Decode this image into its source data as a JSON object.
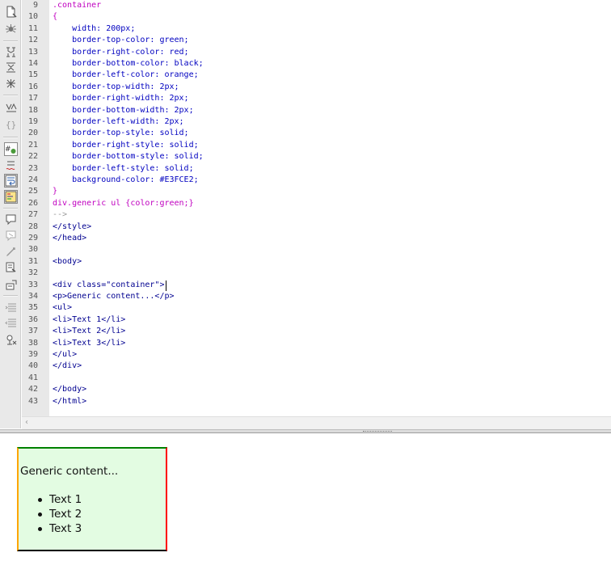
{
  "toolbar": {
    "icons": [
      {
        "name": "open-document-icon",
        "active": false
      },
      {
        "name": "bug-icon",
        "active": false
      },
      {
        "name": "collapse-full-tag-icon",
        "active": false
      },
      {
        "name": "collapse-selection-icon",
        "active": false
      },
      {
        "name": "expand-all-icon",
        "active": false
      },
      {
        "name": "select-parent-tag-icon",
        "active": false
      },
      {
        "name": "balance-braces-icon",
        "active": false
      },
      {
        "name": "line-numbers-icon",
        "active": true
      },
      {
        "name": "highlight-invalid-code-icon",
        "active": false
      },
      {
        "name": "word-wrap-icon",
        "active": true
      },
      {
        "name": "syntax-coloring-icon",
        "active": true
      },
      {
        "name": "apply-comment-icon",
        "active": false
      },
      {
        "name": "remove-comment-icon",
        "active": false
      },
      {
        "name": "wrap-tag-icon",
        "active": false
      },
      {
        "name": "recent-snippets-icon",
        "active": false
      },
      {
        "name": "move-css-icon",
        "active": false
      },
      {
        "name": "indent-code-icon",
        "active": false
      },
      {
        "name": "outdent-code-icon",
        "active": false
      },
      {
        "name": "format-source-icon",
        "active": false
      }
    ]
  },
  "editor": {
    "lines": [
      {
        "num": "9",
        "text": ".container",
        "type": "sel"
      },
      {
        "num": "10",
        "text": "{",
        "type": "sel"
      },
      {
        "num": "11",
        "text": "    width: 200px;",
        "type": "prop"
      },
      {
        "num": "12",
        "text": "    border-top-color: green;",
        "type": "prop"
      },
      {
        "num": "13",
        "text": "    border-right-color: red;",
        "type": "prop"
      },
      {
        "num": "14",
        "text": "    border-bottom-color: black;",
        "type": "prop"
      },
      {
        "num": "15",
        "text": "    border-left-color: orange;",
        "type": "prop"
      },
      {
        "num": "16",
        "text": "    border-top-width: 2px;",
        "type": "prop"
      },
      {
        "num": "17",
        "text": "    border-right-width: 2px;",
        "type": "prop"
      },
      {
        "num": "18",
        "text": "    border-bottom-width: 2px;",
        "type": "prop"
      },
      {
        "num": "19",
        "text": "    border-left-width: 2px;",
        "type": "prop"
      },
      {
        "num": "20",
        "text": "    border-top-style: solid;",
        "type": "prop"
      },
      {
        "num": "21",
        "text": "    border-right-style: solid;",
        "type": "prop"
      },
      {
        "num": "22",
        "text": "    border-bottom-style: solid;",
        "type": "prop"
      },
      {
        "num": "23",
        "text": "    border-left-style: solid;",
        "type": "prop"
      },
      {
        "num": "24",
        "text": "    background-color: #E3FCE2;",
        "type": "prop"
      },
      {
        "num": "25",
        "text": "}",
        "type": "sel"
      },
      {
        "num": "26",
        "text": "div.generic ul {color:green;}",
        "type": "sel"
      },
      {
        "num": "27",
        "text": "-->",
        "type": "cmt"
      },
      {
        "num": "28",
        "text": "</style>",
        "type": "tag"
      },
      {
        "num": "29",
        "text": "</head>",
        "type": "tag"
      },
      {
        "num": "30",
        "text": "",
        "type": "tag"
      },
      {
        "num": "31",
        "text": "<body>",
        "type": "tag"
      },
      {
        "num": "32",
        "text": "",
        "type": "tag"
      },
      {
        "num": "33",
        "text": "<div class=\"container\">",
        "type": "tag"
      },
      {
        "num": "34",
        "text": "<p>Generic content...</p>",
        "type": "tag"
      },
      {
        "num": "35",
        "text": "<ul>",
        "type": "tag"
      },
      {
        "num": "36",
        "text": "<li>Text 1</li>",
        "type": "tag"
      },
      {
        "num": "37",
        "text": "<li>Text 2</li>",
        "type": "tag"
      },
      {
        "num": "38",
        "text": "<li>Text 3</li>",
        "type": "tag"
      },
      {
        "num": "39",
        "text": "</ul>",
        "type": "tag"
      },
      {
        "num": "40",
        "text": "</div>",
        "type": "tag"
      },
      {
        "num": "41",
        "text": "",
        "type": "tag"
      },
      {
        "num": "42",
        "text": "</body>",
        "type": "tag"
      },
      {
        "num": "43",
        "text": "</html>",
        "type": "tag"
      }
    ],
    "caret_line": "33"
  },
  "colors": {
    "selector": "#c000c0",
    "property": "#0000c0",
    "tag": "#000090",
    "comment": "#9a9a9a",
    "container_background": "#E3FCE2",
    "border_top": "green",
    "border_right": "red",
    "border_bottom": "black",
    "border_left": "orange"
  },
  "preview": {
    "paragraph": "Generic content...",
    "items": [
      "Text 1",
      "Text 2",
      "Text 3"
    ]
  }
}
